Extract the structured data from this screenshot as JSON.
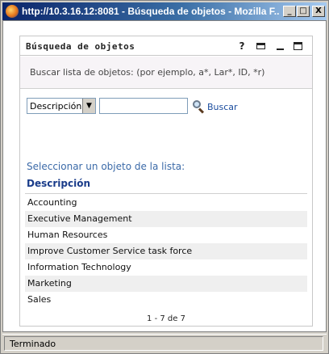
{
  "window": {
    "title": "http://10.3.16.12:8081 - Búsqueda de objetos - Mozilla F...",
    "min_glyph": "_",
    "max_glyph": "□",
    "close_glyph": "X"
  },
  "portlet": {
    "title": "Búsqueda de objetos",
    "help_glyph": "?"
  },
  "info": {
    "text": "Buscar lista de objetos: (por ejemplo, a*, Lar*, ID, *r)"
  },
  "search": {
    "field_selected": "Descripción",
    "arrow_glyph": "▼",
    "input_value": "",
    "button_label": "Buscar"
  },
  "results": {
    "caption": "Seleccionar un objeto de la lista:",
    "column_header": "Descripción",
    "items": [
      "Accounting",
      "Executive Management",
      "Human Resources",
      "Improve Customer Service task force",
      "Information Technology",
      "Marketing",
      "Sales"
    ],
    "pager": "1 - 7 de 7"
  },
  "status": {
    "text": "Terminado"
  }
}
